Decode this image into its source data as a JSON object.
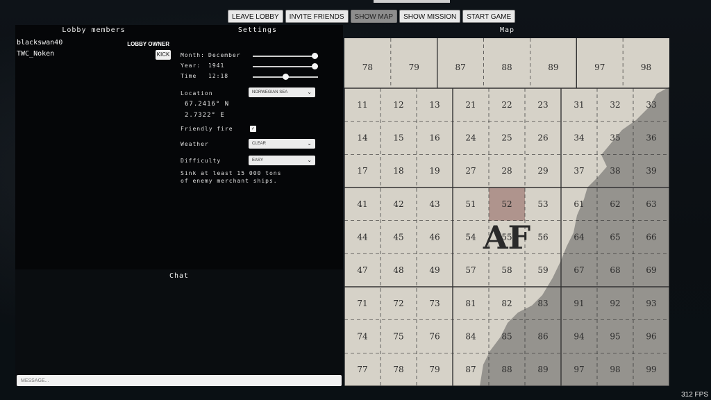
{
  "toolbar": {
    "leave_lobby": "LEAVE LOBBY",
    "invite_friends": "INVITE FRIENDS",
    "show_map": "SHOW MAP",
    "show_mission": "SHOW MISSION",
    "start_game": "START GAME"
  },
  "members": {
    "title": "Lobby members",
    "list": [
      {
        "name": "blackswan40",
        "role": "LOBBY OWNER"
      },
      {
        "name": "TWC_Noken",
        "action": "KICK"
      }
    ]
  },
  "settings": {
    "title": "Settings",
    "month_label": "Month:",
    "month_value": "December",
    "year_label": "Year:",
    "year_value": "1941",
    "time_label": "Time",
    "time_value": "12:18",
    "month_slider": 1.0,
    "year_slider": 1.0,
    "time_slider": 0.5,
    "location_label": "Location",
    "location_value": "NORWEGIAN SEA",
    "latitude": "67.2416° N",
    "longitude": "2.7322° E",
    "friendly_fire_label": "Friendly fire",
    "friendly_fire_checked": true,
    "weather_label": "Weather",
    "weather_value": "CLEAR",
    "difficulty_label": "Difficulty",
    "difficulty_value": "EASY",
    "mission_text": "Sink at least 15 000 tons of enemy merchant ships."
  },
  "chat": {
    "title": "Chat",
    "placeholder": "MESSAGE..."
  },
  "map": {
    "title": "Map",
    "square_label": "AF",
    "highlighted_cell": "52",
    "top_row": [
      "78",
      "79",
      "87",
      "88",
      "89",
      "97",
      "98"
    ],
    "grid_rows": [
      [
        "11",
        "12",
        "13",
        "21",
        "22",
        "23",
        "31",
        "32",
        "33"
      ],
      [
        "14",
        "15",
        "16",
        "24",
        "25",
        "26",
        "34",
        "35",
        "36"
      ],
      [
        "17",
        "18",
        "19",
        "27",
        "28",
        "29",
        "37",
        "38",
        "39"
      ],
      [
        "41",
        "42",
        "43",
        "51",
        "52",
        "53",
        "61",
        "62",
        "63"
      ],
      [
        "44",
        "45",
        "46",
        "54",
        "55",
        "56",
        "64",
        "65",
        "66"
      ],
      [
        "47",
        "48",
        "49",
        "57",
        "58",
        "59",
        "67",
        "68",
        "69"
      ],
      [
        "71",
        "72",
        "73",
        "81",
        "82",
        "83",
        "91",
        "92",
        "93"
      ],
      [
        "74",
        "75",
        "76",
        "84",
        "85",
        "86",
        "94",
        "95",
        "96"
      ],
      [
        "77",
        "78",
        "79",
        "87",
        "88",
        "89",
        "97",
        "98",
        "99"
      ]
    ]
  },
  "fps": "312 FPS",
  "colors": {
    "map_paper": "#d6d2c8",
    "land": "#8a8884",
    "highlight": "#a88a82",
    "panel": "#050608"
  }
}
